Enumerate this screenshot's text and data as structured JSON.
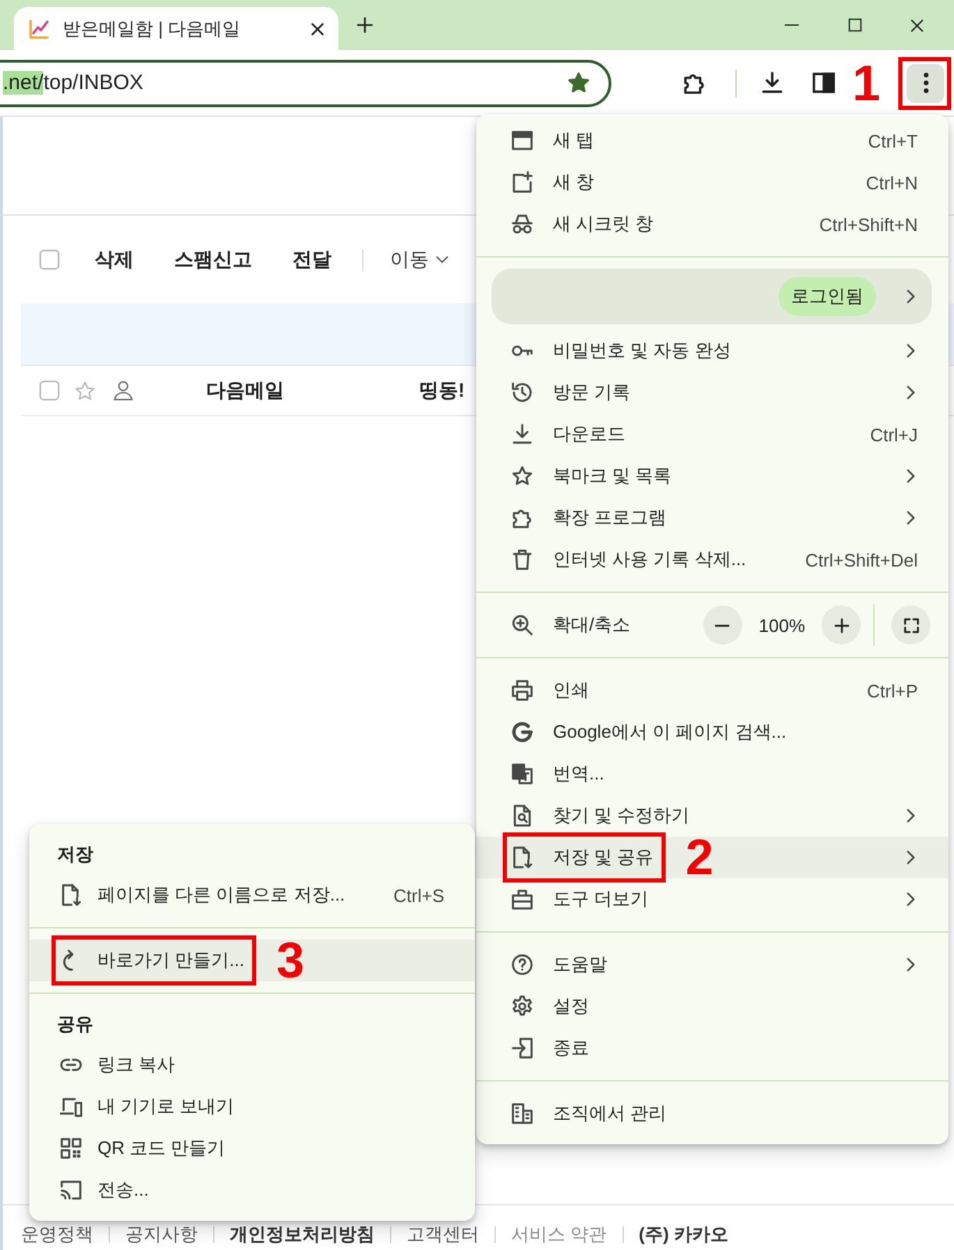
{
  "browser": {
    "tabs": [
      {
        "title": "받은메일함 | 다음메일",
        "selected": true
      }
    ],
    "address_bar": {
      "url_parts": [
        {
          "text": ".net/",
          "selected": true
        },
        {
          "text": "top/INBOX",
          "selected": false
        }
      ],
      "bookmarked": true
    },
    "menu_button": {
      "pressed": true,
      "annotation": "1"
    }
  },
  "mail": {
    "toolbar": {
      "select_all_checked": false,
      "actions": [
        "삭제",
        "스팸신고",
        "전달"
      ],
      "move_label": "이동"
    },
    "messages": [
      {
        "checked": false,
        "starred": false,
        "sender": "다음메일",
        "subject": "띵동!"
      }
    ],
    "footer_links": [
      {
        "label": "운영정책",
        "kind": "normal"
      },
      {
        "label": "공지사항",
        "kind": "normal"
      },
      {
        "label": "개인정보처리방침",
        "kind": "bold"
      },
      {
        "label": "고객센터",
        "kind": "normal"
      },
      {
        "label": "서비스 약관",
        "kind": "muted"
      },
      {
        "label": "(주) 카카오",
        "kind": "bold"
      }
    ]
  },
  "main_menu": {
    "sections": [
      {
        "items": [
          {
            "kind": "item",
            "label": "새 탭",
            "shortcut": "Ctrl+T",
            "has_submenu": false,
            "highlighted": false
          },
          {
            "kind": "item",
            "label": "새 창",
            "shortcut": "Ctrl+N",
            "has_submenu": false,
            "highlighted": false
          },
          {
            "kind": "item",
            "label": "새 시크릿 창",
            "shortcut": "Ctrl+Shift+N",
            "has_submenu": false,
            "highlighted": false
          }
        ]
      },
      {
        "items": [
          {
            "kind": "profile",
            "badge": "로그인됨",
            "has_submenu": true,
            "highlighted": false
          },
          {
            "kind": "item",
            "label": "비밀번호 및 자동 완성",
            "has_submenu": true,
            "highlighted": false
          },
          {
            "kind": "item",
            "label": "방문 기록",
            "has_submenu": true,
            "highlighted": false
          },
          {
            "kind": "item",
            "label": "다운로드",
            "shortcut": "Ctrl+J",
            "has_submenu": false,
            "highlighted": false
          },
          {
            "kind": "item",
            "label": "북마크 및 목록",
            "has_submenu": true,
            "highlighted": false
          },
          {
            "kind": "item",
            "label": "확장 프로그램",
            "has_submenu": true,
            "highlighted": false
          },
          {
            "kind": "item",
            "label": "인터넷 사용 기록 삭제...",
            "shortcut": "Ctrl+Shift+Del",
            "has_submenu": false,
            "highlighted": false
          }
        ]
      },
      {
        "items": [
          {
            "kind": "zoom",
            "label": "확대/축소",
            "value": "100%",
            "highlighted": false
          }
        ]
      },
      {
        "items": [
          {
            "kind": "item",
            "label": "인쇄",
            "shortcut": "Ctrl+P",
            "has_submenu": false,
            "highlighted": false
          },
          {
            "kind": "item",
            "label": "Google에서 이 페이지 검색...",
            "has_submenu": false,
            "highlighted": false
          },
          {
            "kind": "item",
            "label": "번역...",
            "has_submenu": false,
            "highlighted": false
          },
          {
            "kind": "item",
            "label": "찾기 및 수정하기",
            "has_submenu": true,
            "highlighted": false
          },
          {
            "kind": "item",
            "label": "저장 및 공유",
            "has_submenu": true,
            "highlighted": true,
            "annotation": "2"
          },
          {
            "kind": "item",
            "label": "도구 더보기",
            "has_submenu": true,
            "highlighted": false
          }
        ]
      },
      {
        "items": [
          {
            "kind": "item",
            "label": "도움말",
            "has_submenu": true,
            "highlighted": false
          },
          {
            "kind": "item",
            "label": "설정",
            "has_submenu": false,
            "highlighted": false
          },
          {
            "kind": "item",
            "label": "종료",
            "has_submenu": false,
            "highlighted": false
          }
        ]
      },
      {
        "items": [
          {
            "kind": "item",
            "label": "조직에서 관리",
            "has_submenu": false,
            "highlighted": false
          }
        ]
      }
    ]
  },
  "save_share_submenu": {
    "sections": [
      {
        "heading": "저장",
        "items": [
          {
            "label": "페이지를 다른 이름으로 저장...",
            "shortcut": "Ctrl+S",
            "highlighted": false
          }
        ]
      },
      {
        "items": [
          {
            "label": "바로가기 만들기...",
            "highlighted": true,
            "annotation": "3"
          }
        ]
      },
      {
        "heading": "공유",
        "items": [
          {
            "label": "링크 복사",
            "highlighted": false
          },
          {
            "label": "내 기기로 보내기",
            "highlighted": false
          },
          {
            "label": "QR 코드 만들기",
            "highlighted": false
          },
          {
            "label": "전송...",
            "highlighted": false
          }
        ]
      }
    ]
  }
}
